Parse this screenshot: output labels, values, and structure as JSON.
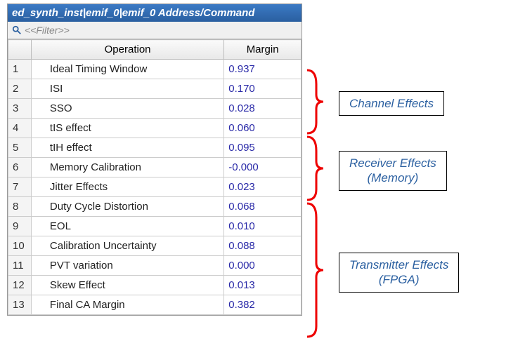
{
  "title": "ed_synth_inst|emif_0|emif_0 Address/Command",
  "filter_placeholder": "<<Filter>>",
  "columns": {
    "rownum": "",
    "operation": "Operation",
    "margin": "Margin"
  },
  "rows": [
    {
      "n": "1",
      "op": "Ideal Timing Window",
      "margin": "0.937"
    },
    {
      "n": "2",
      "op": "ISI",
      "margin": "0.170"
    },
    {
      "n": "3",
      "op": "SSO",
      "margin": "0.028"
    },
    {
      "n": "4",
      "op": "tIS effect",
      "margin": "0.060"
    },
    {
      "n": "5",
      "op": "tIH effect",
      "margin": "0.095"
    },
    {
      "n": "6",
      "op": "Memory Calibration",
      "margin": "-0.000"
    },
    {
      "n": "7",
      "op": "Jitter Effects",
      "margin": "0.023"
    },
    {
      "n": "8",
      "op": "Duty Cycle Distortion",
      "margin": "0.068"
    },
    {
      "n": "9",
      "op": "EOL",
      "margin": "0.010"
    },
    {
      "n": "10",
      "op": "Calibration Uncertainty",
      "margin": "0.088"
    },
    {
      "n": "11",
      "op": "PVT variation",
      "margin": "0.000"
    },
    {
      "n": "12",
      "op": "Skew Effect",
      "margin": "0.013"
    },
    {
      "n": "13",
      "op": "Final CA Margin",
      "margin": "0.382"
    }
  ],
  "annotations": {
    "channel": "Channel Effects",
    "receiver_l1": "Receiver Effects",
    "receiver_l2": "(Memory)",
    "transmitter_l1": "Transmitter Effects",
    "transmitter_l2": "(FPGA)"
  }
}
